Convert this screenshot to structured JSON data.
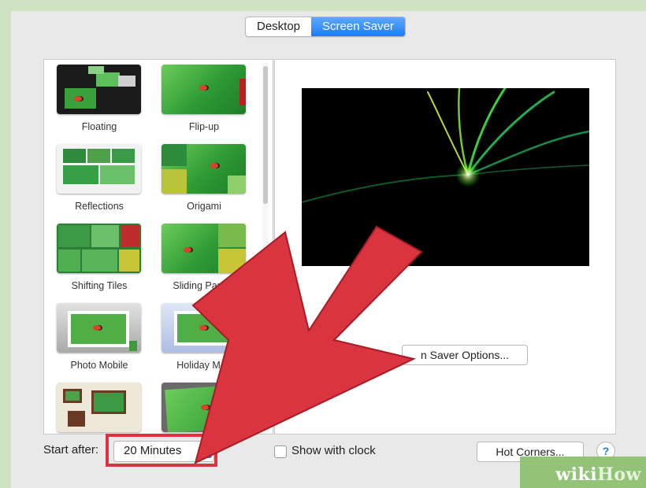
{
  "tabs": [
    {
      "label": "Desktop",
      "active": false
    },
    {
      "label": "Screen Saver",
      "active": true
    }
  ],
  "screensavers": [
    {
      "label": "Floating"
    },
    {
      "label": "Flip-up"
    },
    {
      "label": "Reflections"
    },
    {
      "label": "Origami"
    },
    {
      "label": "Shifting Tiles"
    },
    {
      "label": "Sliding Panels"
    },
    {
      "label": "Photo Mobile"
    },
    {
      "label": "Holiday Mob"
    },
    {
      "label": ""
    },
    {
      "label": ""
    }
  ],
  "preview": {
    "options_button": "n Saver Options..."
  },
  "bottom": {
    "start_after_label": "Start after:",
    "start_after_value": "20 Minutes",
    "show_with_clock_label": "Show with clock",
    "show_with_clock_checked": false,
    "hot_corners_label": "Hot Corners...",
    "help_label": "?"
  },
  "watermark": {
    "part1": "wiki",
    "part2": "How"
  },
  "colors": {
    "accent": "#1f7cf2",
    "arrow": "#d9343f",
    "highlight": "#d9343f"
  }
}
